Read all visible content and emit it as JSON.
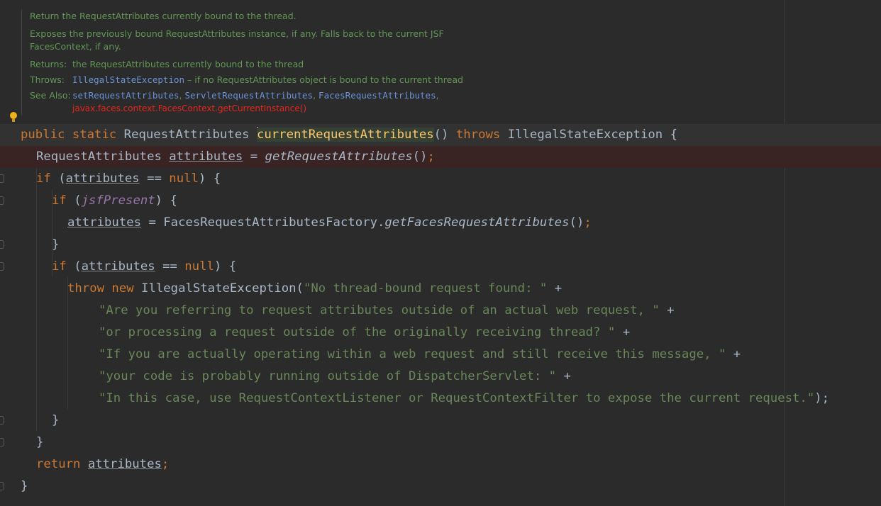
{
  "doc": {
    "summary": "Return the RequestAttributes currently bound to the thread.",
    "description_1": "Exposes the previously bound RequestAttributes instance, if any. Falls back to the current JSF",
    "description_2": "FacesContext, if any.",
    "returns_label": "Returns:",
    "returns_text": "the RequestAttributes currently bound to the thread",
    "throws_label": "Throws:",
    "throws_link": "IllegalStateException",
    "throws_text": " – if no RequestAttributes object is bound to the current thread",
    "see_also_label": "See Also:",
    "see_also_links": [
      "setRequestAttributes",
      "ServletRequestAttributes",
      "FacesRequestAttributes"
    ],
    "see_also_broken": "javax.faces.context.FacesContext.getCurrentInstance()"
  },
  "code": {
    "l1": {
      "mod": "public static ",
      "type": "RequestAttributes ",
      "method": "currentRequestAttributes",
      "paren": "() ",
      "throws": "throws ",
      "exc": "IllegalStateException {"
    },
    "l2": {
      "type": "RequestAttributes ",
      "var": "attributes",
      "eq": " = ",
      "call": "getRequestAttributes",
      "end": "()",
      "semi": ";"
    },
    "l3": {
      "kw": "if ",
      "open": "(",
      "var": "attributes",
      "op": " == ",
      "null": "null",
      "close": ") {"
    },
    "l4": {
      "kw": "if ",
      "open": "(",
      "field": "jsfPresent",
      "close": ") {"
    },
    "l5": {
      "var": "attributes",
      "mid": " = FacesRequestAttributesFactory.",
      "call": "getFacesRequestAttributes",
      "end": "()",
      "semi": ";"
    },
    "l6": "}",
    "l7": {
      "kw": "if ",
      "open": "(",
      "var": "attributes",
      "op": " == ",
      "null": "null",
      "close": ") {"
    },
    "l8": {
      "kw": "throw new ",
      "cls": "IllegalStateException(",
      "str": "\"No thread-bound request found: \"",
      "plus": " +"
    },
    "l9": {
      "str": "\"Are you referring to request attributes outside of an actual web request, \"",
      "plus": " +"
    },
    "l10": {
      "str": "\"or processing a request outside of the originally receiving thread? \"",
      "plus": " +"
    },
    "l11": {
      "str": "\"If you are actually operating within a web request and still receive this message, \"",
      "plus": " +"
    },
    "l12": {
      "str": "\"your code is probably running outside of DispatcherServlet: \"",
      "plus": " +"
    },
    "l13": {
      "str": "\"In this case, use RequestContextListener or RequestContextFilter to expose the current request.\"",
      "end": ");"
    },
    "l14": "}",
    "l15": "}",
    "l16": {
      "kw": "return ",
      "var": "attributes",
      "semi": ";"
    },
    "l17": "}"
  },
  "colors": {
    "background": "#2b2b2b",
    "keyword": "#cc7832",
    "string": "#6a8759",
    "method_decl": "#ffc66d",
    "static_field": "#9876aa",
    "doc_text": "#629755",
    "doc_link": "#6a93d6",
    "error": "#e8261c"
  },
  "icons": [
    "intention-bulb-icon",
    "fold-marker-icon"
  ]
}
